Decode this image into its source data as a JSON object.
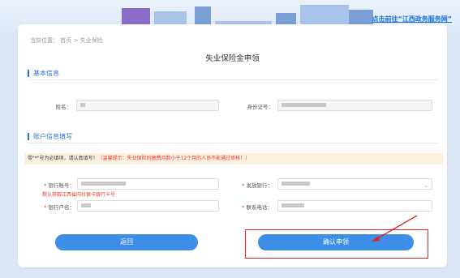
{
  "banner": {
    "link": "点击前往“江西政务服务网”"
  },
  "breadcrumb": {
    "prefix": "当前位置：",
    "home": "首页",
    "sep": ">",
    "current": "失业保险"
  },
  "page_title": "失业保险金申领",
  "basic_info": {
    "heading": "基本信息",
    "name_label": "姓名：",
    "id_label": "身份证号："
  },
  "account_info": {
    "heading": "账户信息填写",
    "notice_prefix": "带\"*\"号为必填项，请认真填写！",
    "notice_warning": "（温馨提示：失业保险的缴费月数小于12个月的人员不能通过审核！）",
    "bank_account_label": "银行账号：",
    "bank_account_hint": "默认获取江西省内社保卡银行卡号",
    "issuing_bank_label": "发放银行：",
    "holder_label": "银行户名：",
    "phone_label": "联系电话："
  },
  "buttons": {
    "back": "返回",
    "confirm": "确认申领"
  },
  "colors": {
    "accent": "#3d8ee6",
    "warning": "#e33333",
    "highlight_box": "#e02222"
  }
}
